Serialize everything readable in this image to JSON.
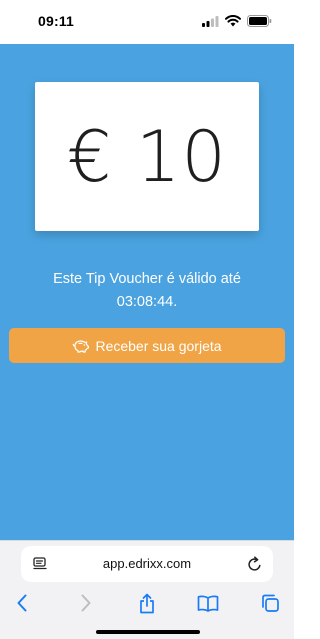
{
  "status_bar": {
    "time": "09:11",
    "icons": [
      "cellular-icon",
      "wifi-icon",
      "battery-icon"
    ]
  },
  "voucher": {
    "amount": "€ 10"
  },
  "validity": {
    "line1": "Este Tip Voucher é válido até",
    "line2": "03:08:44."
  },
  "claim_button": {
    "label": "Receber sua gorjeta",
    "icon": "piggy-bank-icon"
  },
  "browser": {
    "url": "app.edrixx.com",
    "toolbar": [
      "back-icon",
      "forward-icon",
      "share-icon",
      "bookmarks-icon",
      "tabs-icon"
    ]
  },
  "colors": {
    "background": "#4aa3e0",
    "button": "#f0a445",
    "card": "#ffffff",
    "accent": "#1a7cf5"
  }
}
